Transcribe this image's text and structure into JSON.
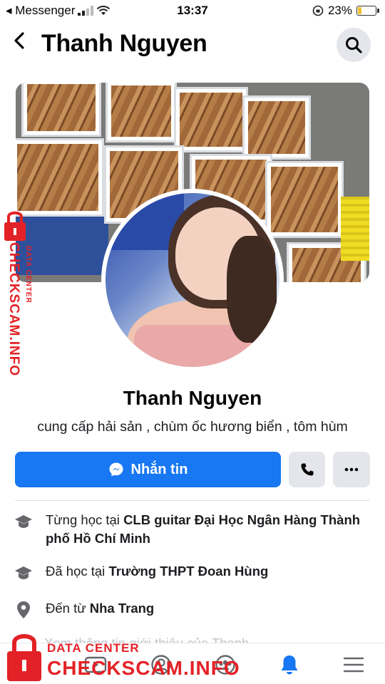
{
  "status_bar": {
    "carrier": "◂ Messenger",
    "time": "13:37",
    "battery_percent": "23%",
    "battery_level": 0.23
  },
  "header": {
    "title": "Thanh Nguyen"
  },
  "profile": {
    "name": "Thanh Nguyen",
    "bio": "cung cấp hải sản , chùm ốc hương biển , tôm hùm"
  },
  "actions": {
    "message_label": "Nhắn tin"
  },
  "details": [
    {
      "prefix": "Từng học tại ",
      "value": "CLB guitar Đại Học Ngân Hàng Thành phố Hồ Chí Minh",
      "icon": "graduation-cap-icon"
    },
    {
      "prefix": "Đã học tại ",
      "value": "Trường THPT Đoan Hùng",
      "icon": "graduation-cap-icon"
    },
    {
      "prefix": "Đến từ ",
      "value": "Nha Trang",
      "icon": "location-pin-icon"
    }
  ],
  "faded_text": "Xem thông tin giới thiệu của Thanh",
  "tabbar": [
    "home-icon",
    "video-icon",
    "profile-icon",
    "groups-icon",
    "bell-icon",
    "menu-icon"
  ],
  "watermark": {
    "side_text": "CHECKSCAM.INFO",
    "side_small": "DATA CENTER",
    "bottom_small": "DATA CENTER",
    "bottom_big": "CHECKSCAM.INFO"
  },
  "colors": {
    "accent": "#1877f2",
    "button_gray": "#e4e6eb",
    "watermark_red": "#e32227"
  }
}
